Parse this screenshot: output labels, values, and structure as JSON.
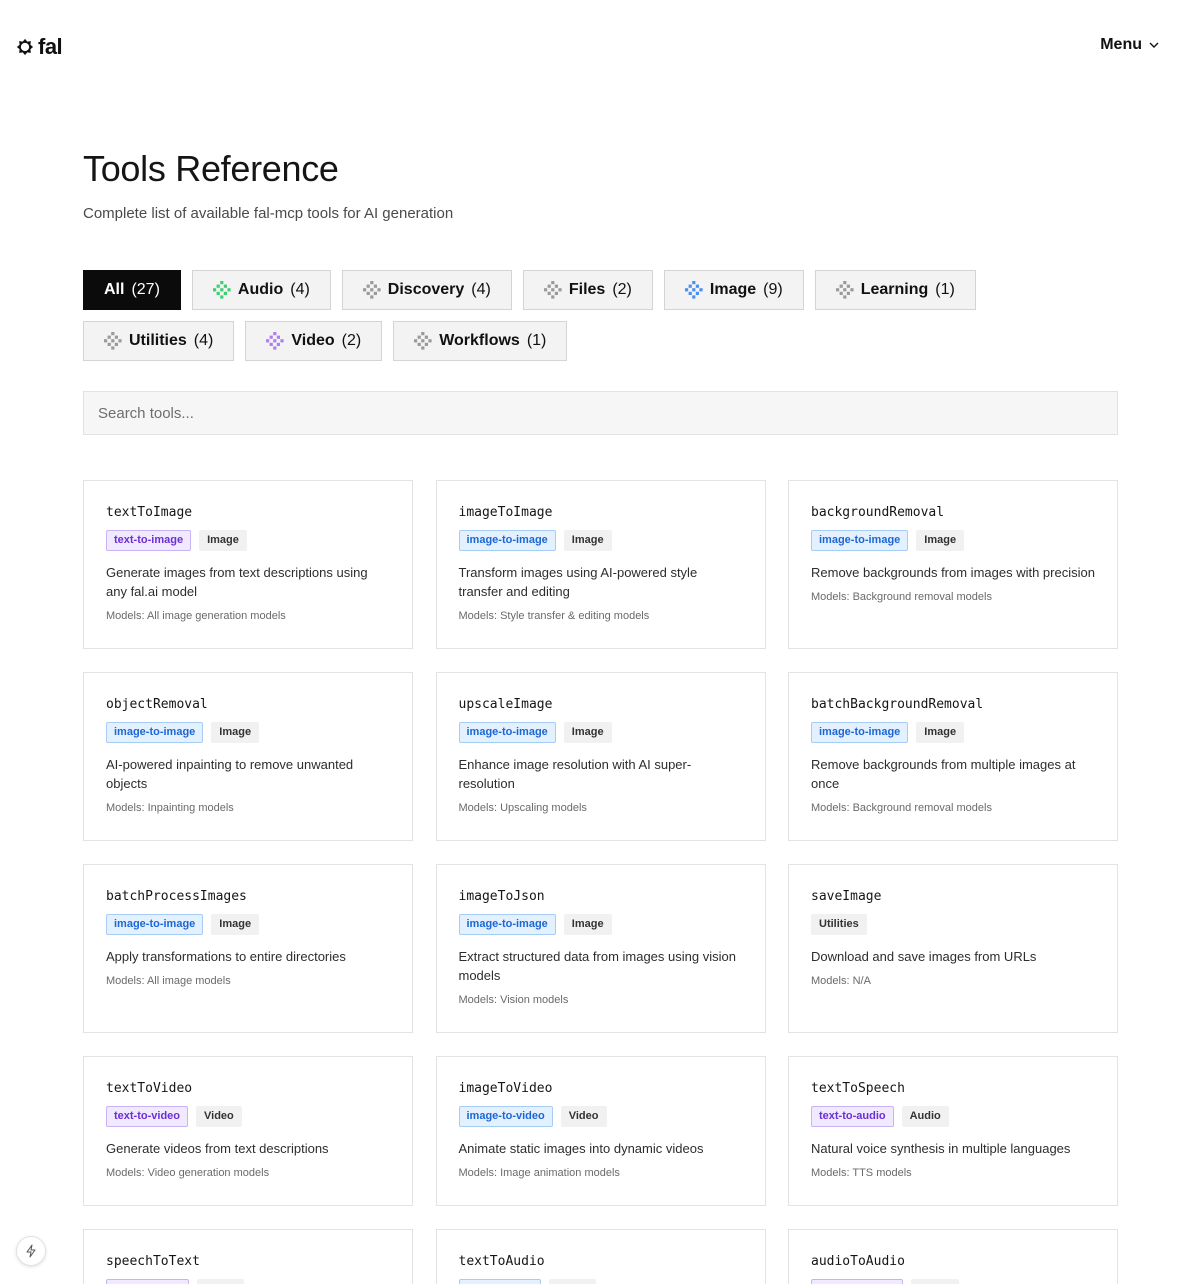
{
  "header": {
    "logo_text": "fal",
    "menu_label": "Menu"
  },
  "page": {
    "title": "Tools Reference",
    "subtitle": "Complete list of available fal-mcp tools for AI generation"
  },
  "filters": [
    {
      "label": "All",
      "count": "(27)",
      "active": true,
      "icon": "none",
      "color": ""
    },
    {
      "label": "Audio",
      "count": "(4)",
      "active": false,
      "icon": "pixel-diamond-icon",
      "color": "#3fcf72"
    },
    {
      "label": "Discovery",
      "count": "(4)",
      "active": false,
      "icon": "pixel-diamond-icon",
      "color": "#9a9a9a"
    },
    {
      "label": "Files",
      "count": "(2)",
      "active": false,
      "icon": "pixel-diamond-icon",
      "color": "#9a9a9a"
    },
    {
      "label": "Image",
      "count": "(9)",
      "active": false,
      "icon": "pixel-diamond-icon",
      "color": "#4a90f0"
    },
    {
      "label": "Learning",
      "count": "(1)",
      "active": false,
      "icon": "pixel-diamond-icon",
      "color": "#9a9a9a"
    },
    {
      "label": "Utilities",
      "count": "(4)",
      "active": false,
      "icon": "pixel-diamond-icon",
      "color": "#9a9a9a"
    },
    {
      "label": "Video",
      "count": "(2)",
      "active": false,
      "icon": "pixel-diamond-icon",
      "color": "#b07ef0"
    },
    {
      "label": "Workflows",
      "count": "(1)",
      "active": false,
      "icon": "pixel-diamond-icon",
      "color": "#9a9a9a"
    }
  ],
  "search": {
    "placeholder": "Search tools..."
  },
  "tools": [
    {
      "name": "textToImage",
      "tags": [
        {
          "text": "text-to-image",
          "style": "purple"
        },
        {
          "text": "Image",
          "style": "gray"
        }
      ],
      "description": "Generate images from text descriptions using any fal.ai model",
      "models": "Models: All image generation models"
    },
    {
      "name": "imageToImage",
      "tags": [
        {
          "text": "image-to-image",
          "style": "blue"
        },
        {
          "text": "Image",
          "style": "gray"
        }
      ],
      "description": "Transform images using AI-powered style transfer and editing",
      "models": "Models: Style transfer & editing models"
    },
    {
      "name": "backgroundRemoval",
      "tags": [
        {
          "text": "image-to-image",
          "style": "blue"
        },
        {
          "text": "Image",
          "style": "gray"
        }
      ],
      "description": "Remove backgrounds from images with precision",
      "models": "Models: Background removal models"
    },
    {
      "name": "objectRemoval",
      "tags": [
        {
          "text": "image-to-image",
          "style": "blue"
        },
        {
          "text": "Image",
          "style": "gray"
        }
      ],
      "description": "AI-powered inpainting to remove unwanted objects",
      "models": "Models: Inpainting models"
    },
    {
      "name": "upscaleImage",
      "tags": [
        {
          "text": "image-to-image",
          "style": "blue"
        },
        {
          "text": "Image",
          "style": "gray"
        }
      ],
      "description": "Enhance image resolution with AI super-resolution",
      "models": "Models: Upscaling models"
    },
    {
      "name": "batchBackgroundRemoval",
      "tags": [
        {
          "text": "image-to-image",
          "style": "blue"
        },
        {
          "text": "Image",
          "style": "gray"
        }
      ],
      "description": "Remove backgrounds from multiple images at once",
      "models": "Models: Background removal models"
    },
    {
      "name": "batchProcessImages",
      "tags": [
        {
          "text": "image-to-image",
          "style": "blue"
        },
        {
          "text": "Image",
          "style": "gray"
        }
      ],
      "description": "Apply transformations to entire directories",
      "models": "Models: All image models"
    },
    {
      "name": "imageToJson",
      "tags": [
        {
          "text": "image-to-image",
          "style": "blue"
        },
        {
          "text": "Image",
          "style": "gray"
        }
      ],
      "description": "Extract structured data from images using vision models",
      "models": "Models: Vision models"
    },
    {
      "name": "saveImage",
      "tags": [
        {
          "text": "Utilities",
          "style": "gray"
        }
      ],
      "description": "Download and save images from URLs",
      "models": "Models: N/A"
    },
    {
      "name": "textToVideo",
      "tags": [
        {
          "text": "text-to-video",
          "style": "purple"
        },
        {
          "text": "Video",
          "style": "gray"
        }
      ],
      "description": "Generate videos from text descriptions",
      "models": "Models: Video generation models"
    },
    {
      "name": "imageToVideo",
      "tags": [
        {
          "text": "image-to-video",
          "style": "blue"
        },
        {
          "text": "Video",
          "style": "gray"
        }
      ],
      "description": "Animate static images into dynamic videos",
      "models": "Models: Image animation models"
    },
    {
      "name": "textToSpeech",
      "tags": [
        {
          "text": "text-to-audio",
          "style": "purple"
        },
        {
          "text": "Audio",
          "style": "gray"
        }
      ],
      "description": "Natural voice synthesis in multiple languages",
      "models": "Models: TTS models"
    },
    {
      "name": "speechToText",
      "tags": [
        {
          "text": "audio-to-text",
          "style": "purple"
        },
        {
          "text": "Audio",
          "style": "gray"
        }
      ],
      "description": "",
      "models": ""
    },
    {
      "name": "textToAudio",
      "tags": [
        {
          "text": "text-to-audio",
          "style": "blue"
        },
        {
          "text": "Audio",
          "style": "gray"
        }
      ],
      "description": "",
      "models": ""
    },
    {
      "name": "audioToAudio",
      "tags": [
        {
          "text": "audio-to-audio",
          "style": "purple"
        },
        {
          "text": "Audio",
          "style": "gray"
        }
      ],
      "description": "",
      "models": ""
    }
  ]
}
